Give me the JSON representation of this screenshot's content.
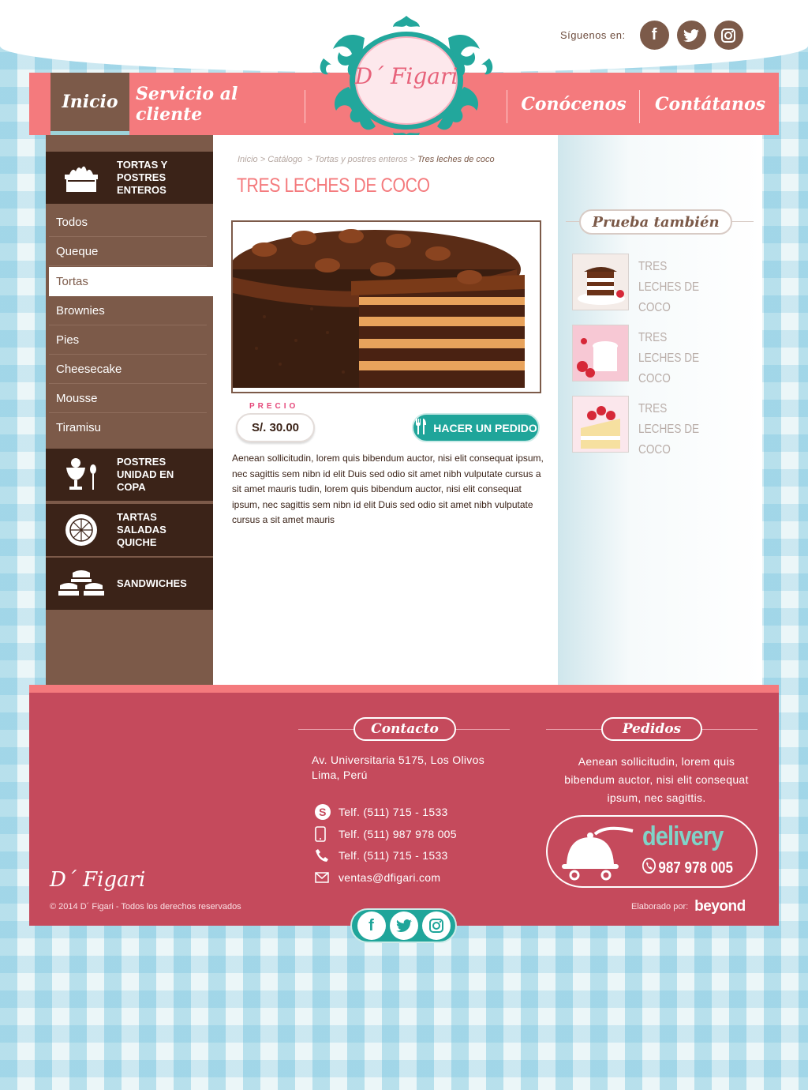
{
  "header": {
    "follow_label": "Síguenos en:",
    "social": [
      "facebook-icon",
      "twitter-icon",
      "instagram-icon"
    ],
    "logo_text": "D´ Figari",
    "nav": [
      {
        "label": "Inicio",
        "active": true
      },
      {
        "label": "Servicio al cliente",
        "active": false
      },
      {
        "label": "Conócenos",
        "active": false
      },
      {
        "label": "Contátanos",
        "active": false
      }
    ]
  },
  "sidebar": {
    "categories": [
      {
        "label": "TORTAS Y POSTRES ENTEROS",
        "icon": "cake-icon"
      },
      {
        "label": "POSTRES UNIDAD EN COPA",
        "icon": "cup-dessert-icon"
      },
      {
        "label": "TARTAS SALADAS QUICHE",
        "icon": "pie-icon"
      },
      {
        "label": "SANDWICHES",
        "icon": "sandwich-icon"
      }
    ],
    "subitems": [
      "Todos",
      "Queque",
      "Tortas",
      "Brownies",
      "Pies",
      "Cheesecake",
      "Mousse",
      "Tiramisu"
    ],
    "active_subitem": "Tortas"
  },
  "main": {
    "breadcrumb": {
      "items": [
        "Inicio",
        "Catálogo",
        "Tortas y postres enteros"
      ],
      "current": "Tres leches de coco"
    },
    "title": "TRES LECHES DE COCO",
    "price_label": "PRECIO",
    "price": "S/. 30.00",
    "order_button": "HACER UN PEDIDO",
    "description": "Aenean sollicitudin, lorem quis bibendum auctor, nisi elit consequat ipsum, nec sagittis sem nibn id elit Duis sed odio sit amet nibh vulputate cursus a sit amet mauris tudin, lorem quis bibendum auctor, nisi elit consequat ipsum, nec sagittis sem nibn id elit Duis sed odio sit amet nibh vulputate cursus a sit amet mauris"
  },
  "related": {
    "title": "Prueba también",
    "items": [
      {
        "name": "TRES LECHES DE COCO"
      },
      {
        "name": "TRES LECHES DE COCO"
      },
      {
        "name": "TRES LECHES DE COCO"
      }
    ]
  },
  "footer": {
    "contact_title": "Contacto",
    "address_line1": "Av. Universitaria 5175, Los Olivos",
    "address_line2": "Lima, Perú",
    "contacts": [
      {
        "icon": "skype-icon",
        "text": "Telf. (511) 715 - 1533"
      },
      {
        "icon": "mobile-phone-icon",
        "text": "Telf. (511) 987 978 005"
      },
      {
        "icon": "phone-icon",
        "text": "Telf. (511) 715 - 1533"
      },
      {
        "icon": "mail-icon",
        "text": "ventas@dfigari.com"
      }
    ],
    "orders_title": "Pedidos",
    "orders_text": "Aenean sollicitudin, lorem quis bibendum auctor, nisi elit consequat ipsum, nec sagittis.",
    "delivery_word": "delivery",
    "delivery_phone": "987 978 005",
    "logo_text": "D´ Figari",
    "copyright": "© 2014 D´ Figari - Todos los derechos reservados",
    "made_by_label": "Elaborado por:",
    "made_by_brand": "beyond"
  },
  "colors": {
    "coral": "#f47a7d",
    "brown": "#7c5a49",
    "dark_brown": "#3b2318",
    "teal": "#1fa59a",
    "footer_red": "#c54a5c"
  }
}
